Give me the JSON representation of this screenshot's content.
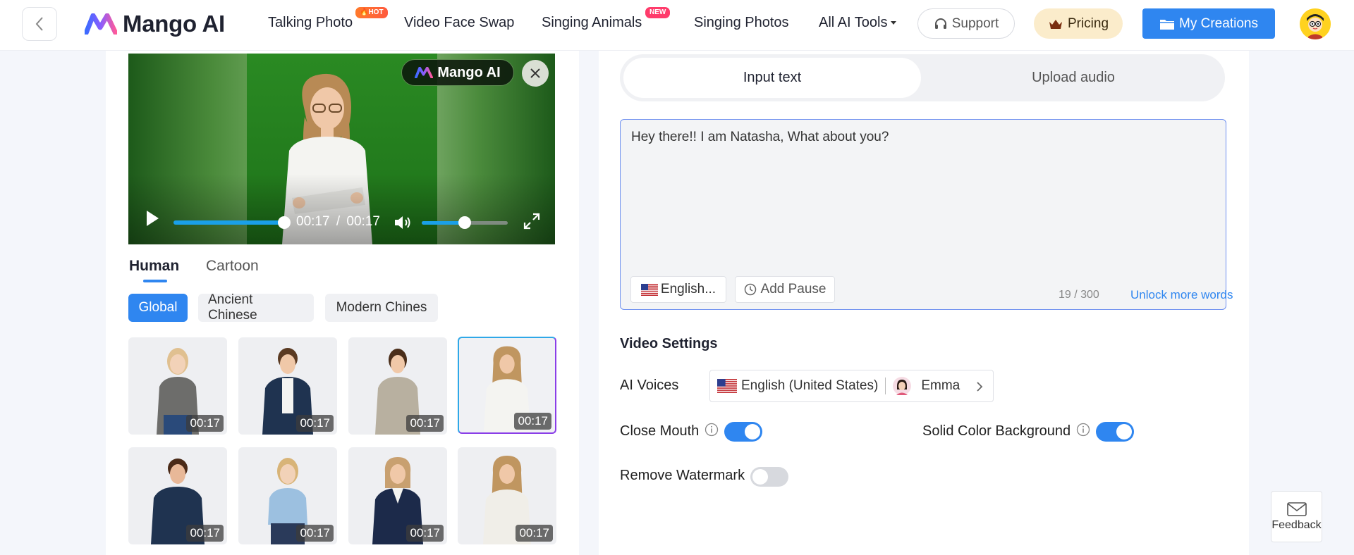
{
  "header": {
    "logo_text": "Mango AI",
    "nav": [
      {
        "label": "Talking Photo",
        "badge": "HOT"
      },
      {
        "label": "Video Face Swap",
        "badge": ""
      },
      {
        "label": "Singing Animals",
        "badge": "NEW"
      },
      {
        "label": "Singing Photos",
        "badge": ""
      },
      {
        "label": "All AI Tools",
        "badge": ""
      }
    ],
    "support_label": "Support",
    "pricing_label": "Pricing",
    "creations_label": "My Creations"
  },
  "player": {
    "watermark_text": "Mango AI",
    "current_time": "00:17",
    "time_separator": "/",
    "duration": "00:17",
    "progress": 1.0,
    "volume": 0.5
  },
  "avatar_tabs": [
    {
      "label": "Human",
      "active": true
    },
    {
      "label": "Cartoon",
      "active": false
    }
  ],
  "categories": [
    {
      "label": "Global",
      "active": true
    },
    {
      "label": "Ancient Chinese",
      "active": false
    },
    {
      "label": "Modern Chines",
      "active": false
    }
  ],
  "avatars": [
    {
      "duration": "00:17",
      "selected": false
    },
    {
      "duration": "00:17",
      "selected": false
    },
    {
      "duration": "00:17",
      "selected": false
    },
    {
      "duration": "00:17",
      "selected": true
    },
    {
      "duration": "00:17",
      "selected": false
    },
    {
      "duration": "00:17",
      "selected": false
    },
    {
      "duration": "00:17",
      "selected": false
    },
    {
      "duration": "00:17",
      "selected": false
    }
  ],
  "input_mode": {
    "text_label": "Input text",
    "audio_label": "Upload audio"
  },
  "script": {
    "value": "Hey there!! I am Natasha, What about you?",
    "language_label": "English...",
    "add_pause_label": "Add Pause",
    "word_count": "19 / 300",
    "unlock_label": "Unlock more words"
  },
  "settings": {
    "title": "Video Settings",
    "ai_voices_label": "AI Voices",
    "voice_language": "English (United States)",
    "voice_name": "Emma",
    "close_mouth_label": "Close Mouth",
    "close_mouth_on": true,
    "solid_bg_label": "Solid Color Background",
    "solid_bg_on": true,
    "remove_watermark_label": "Remove Watermark",
    "remove_watermark_on": false
  },
  "feedback_label": "Feedback",
  "colors": {
    "accent": "#2f86f0",
    "hot_badge": "#ff6a33",
    "new_badge": "#ff3b6b",
    "video_green": "#1f6f1c"
  },
  "icons": [
    "chevron-left-icon",
    "mango-logo-icon",
    "headset-icon",
    "crown-icon",
    "folder-icon",
    "close-icon",
    "play-icon",
    "volume-icon",
    "fullscreen-icon",
    "us-flag-icon",
    "clock-icon",
    "info-icon",
    "chevron-right-icon",
    "mail-icon"
  ]
}
